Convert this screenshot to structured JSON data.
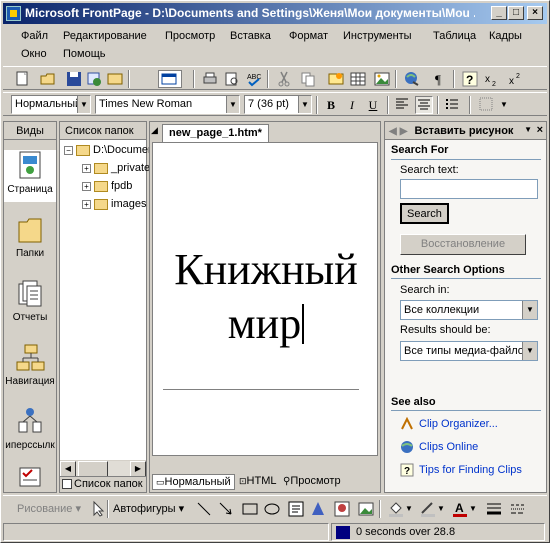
{
  "window": {
    "title": "Microsoft FrontPage - D:\\Documents and Settings\\Женя\\Мои документы\\Моu ..."
  },
  "menu": [
    "Файл",
    "Редактирование",
    "Просмотр",
    "Вставка",
    "Формат",
    "Инструменты",
    "Таблица",
    "Кадры",
    "Окно",
    "Помощь"
  ],
  "format_toolbar": {
    "style": "Нормальный",
    "font": "Times New Roman",
    "size": "7  (36 pt)",
    "bold": "B",
    "italic": "I",
    "underline": "U"
  },
  "views": {
    "header": "Виды",
    "items": [
      "Страница",
      "Папки",
      "Отчеты",
      "Навигация",
      "иперссылк"
    ]
  },
  "folder_list": {
    "header": "Список папок",
    "root": "D:\\Documents",
    "children": [
      "_private",
      "fpdb",
      "images"
    ],
    "tab_label": "Список папок"
  },
  "editor": {
    "tab": "new_page_1.htm*",
    "heading_line1": "Книжный",
    "heading_line2": "мир",
    "modes": [
      "Нормальный",
      "HTML",
      "Просмотр"
    ]
  },
  "task_pane": {
    "title": "Вставить рисунок",
    "search_for": "Search For",
    "search_text_label": "Search text:",
    "search_text_value": "",
    "search_button": "Search",
    "restore_button": "Восстановление",
    "other_options": "Other Search Options",
    "search_in_label": "Search in:",
    "search_in_value": "Все коллекции",
    "results_label": "Results should be:",
    "results_value": "Все типы медиа-файлов",
    "see_also": "See also",
    "links": [
      "Clip Organizer...",
      "Clips Online",
      "Tips for Finding Clips"
    ]
  },
  "drawing_toolbar": {
    "draw_label": "Рисование",
    "autoshapes_label": "Автофигуры"
  },
  "status": {
    "text": "0 seconds over 28.8"
  }
}
